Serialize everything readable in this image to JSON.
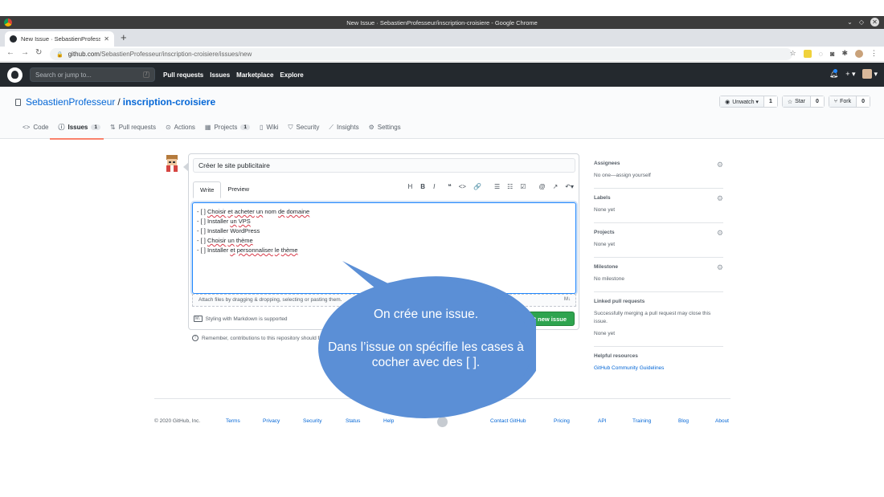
{
  "browser": {
    "window_title": "New Issue · SebastienProfesseur/inscription-croisiere - Google Chrome",
    "tab_title": "New Issue · SebastienProfess",
    "url_host": "github.com",
    "url_path": "/SebastienProfesseur/inscription-croisiere/issues/new"
  },
  "github_header": {
    "search_placeholder": "Search or jump to...",
    "search_shortcut": "/",
    "nav": [
      "Pull requests",
      "Issues",
      "Marketplace",
      "Explore"
    ]
  },
  "repo": {
    "owner": "SebastienProfesseur",
    "separator": "/",
    "name": "inscription-croisiere",
    "watch_label": "Unwatch ▾",
    "watch_count": "1",
    "star_label": "Star",
    "star_count": "0",
    "fork_label": "Fork",
    "fork_count": "0",
    "tabs": [
      {
        "label": "Code",
        "icon": "<>"
      },
      {
        "label": "Issues",
        "icon": "ⓘ",
        "count": "1"
      },
      {
        "label": "Pull requests",
        "icon": "⇅"
      },
      {
        "label": "Actions",
        "icon": "⊙"
      },
      {
        "label": "Projects",
        "icon": "▦",
        "count": "1"
      },
      {
        "label": "Wiki",
        "icon": "▯"
      },
      {
        "label": "Security",
        "icon": "⛉"
      },
      {
        "label": "Insights",
        "icon": "⟋"
      },
      {
        "label": "Settings",
        "icon": "⚙"
      }
    ]
  },
  "issue_form": {
    "title_value": "Créer le site publicitaire",
    "tab_write": "Write",
    "tab_preview": "Preview",
    "toolbar": [
      "H",
      "B",
      "I",
      "❝",
      "<>",
      "🔗",
      "☰",
      "☷",
      "☑",
      "@",
      "↗",
      "↶▾"
    ],
    "body_lines": [
      "- [ ] Choisir et acheter un nom de domaine",
      "- [ ] Installer un VPS",
      "- [ ] Installer WordPress",
      "- [ ] Choisir un thème",
      "- [ ] Installer et personnaliser le thème"
    ],
    "attach_hint": "Attach files by dragging & dropping, selecting or pasting them.",
    "markdown_hint": "Styling with Markdown is supported",
    "submit_label": "Submit new issue",
    "remember_text": "Remember, contributions to this repository should follow our GitHub Community Guidelines."
  },
  "sidebar": [
    {
      "head": "Assignees",
      "value": "No one—assign yourself"
    },
    {
      "head": "Labels",
      "value": "None yet"
    },
    {
      "head": "Projects",
      "value": "None yet"
    },
    {
      "head": "Milestone",
      "value": "No milestone"
    },
    {
      "head": "Linked pull requests",
      "value": "Successfully merging a pull request may close this issue.",
      "value2": "None yet"
    },
    {
      "head": "Helpful resources",
      "value": "GitHub Community Guidelines"
    }
  ],
  "footer": {
    "copyright": "© 2020 GitHub, Inc.",
    "links": [
      "Terms",
      "Privacy",
      "Security",
      "Status",
      "Help",
      "Contact GitHub",
      "Pricing",
      "API",
      "Training",
      "Blog",
      "About"
    ]
  },
  "callout": {
    "line1": "On crée une issue.",
    "line2": "Dans l’issue on spécifie les cases à cocher avec des [ ].",
    "color": "#5b8fd6"
  }
}
